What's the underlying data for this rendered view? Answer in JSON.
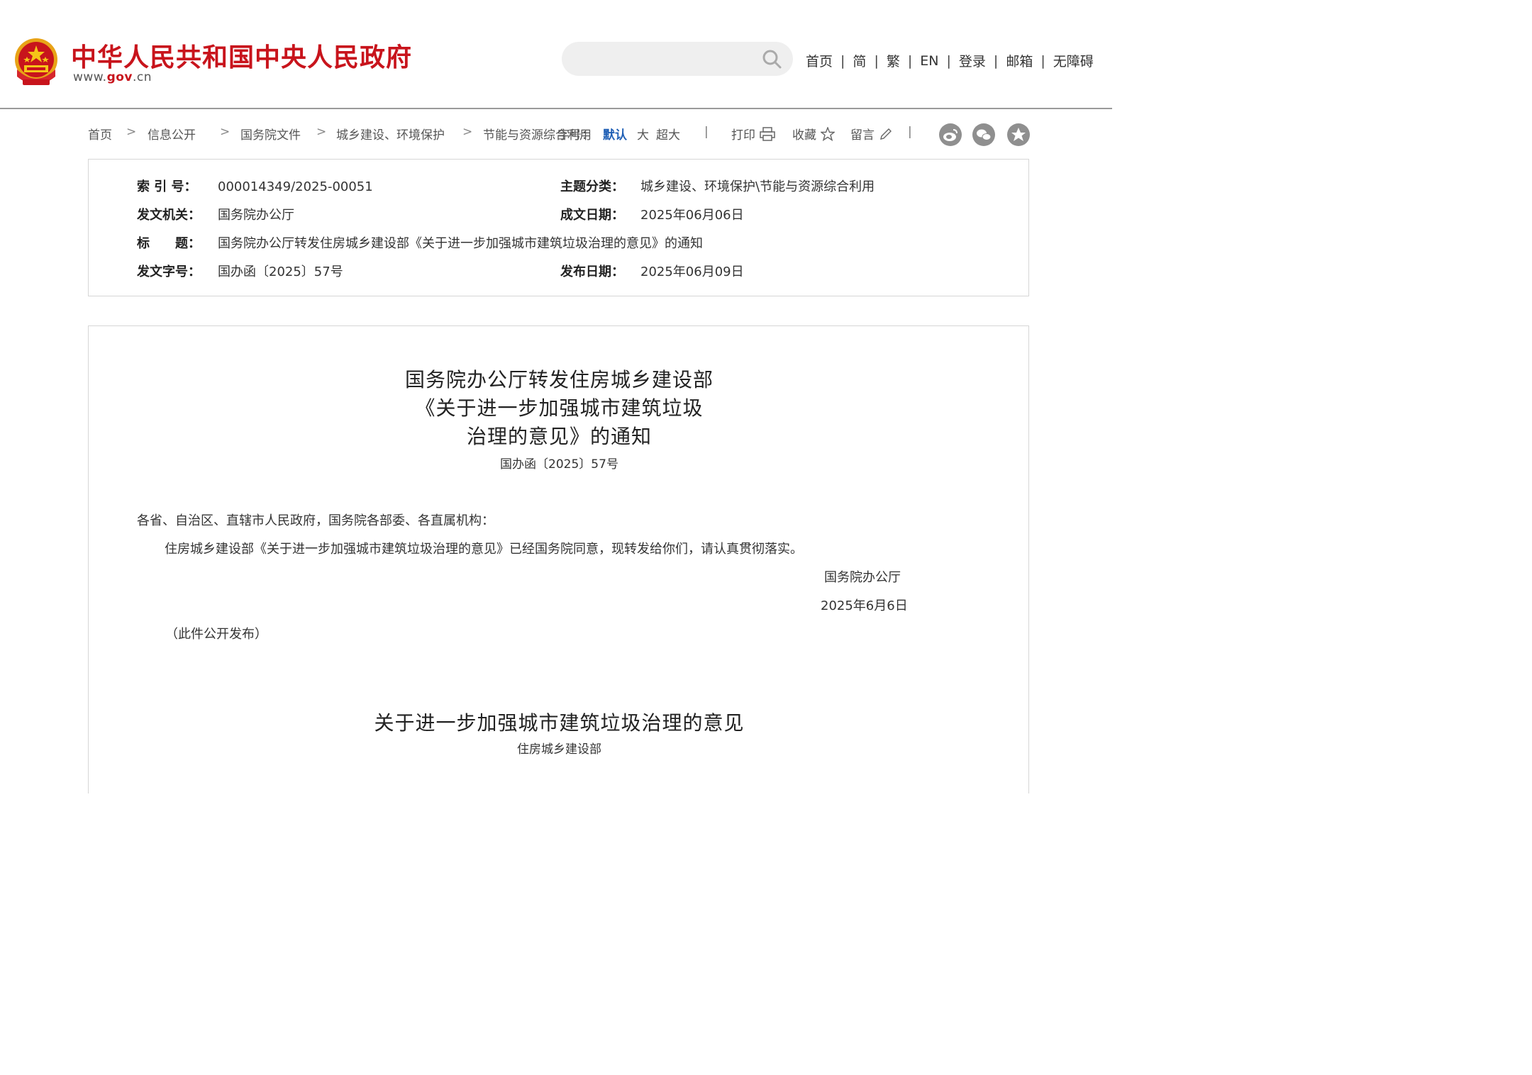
{
  "header": {
    "site_title": "中华人民共和国中央人民政府",
    "site_url_prefix": "www.",
    "site_url_domain": "gov",
    "site_url_suffix": ".cn",
    "search_placeholder": "",
    "nav": [
      "首页",
      "简",
      "繁",
      "EN",
      "登录",
      "邮箱",
      "无障碍"
    ],
    "nav_separator": "|",
    "emblem_color": "#c8141c",
    "emblem_gold": "#f5c518"
  },
  "breadcrumb": {
    "items": [
      "首页",
      "信息公开",
      "国务院文件",
      "城乡建设、环境保护",
      "节能与资源综合利用"
    ],
    "arrow": ">"
  },
  "tools": {
    "font_size_label": "字号：",
    "size_default": "默认",
    "size_large": "大",
    "size_xlarge": "超大",
    "separator": "|",
    "print": "打印",
    "favorite": "收藏",
    "comment": "留言"
  },
  "share": [
    "weibo-icon",
    "wechat-icon",
    "qzone-icon"
  ],
  "meta": {
    "index_label": "索 引 号：",
    "index_value": "000014349/2025-00051",
    "topic_label": "主题分类：",
    "topic_value": "城乡建设、环境保护\\节能与资源综合利用",
    "issuer_label": "发文机关：",
    "issuer_value": "国务院办公厅",
    "written_label": "成文日期：",
    "written_value": "2025年06月06日",
    "title_label": "标　　题：",
    "title_value": "国务院办公厅转发住房城乡建设部《关于进一步加强城市建筑垃圾治理的意见》的通知",
    "docno_label": "发文字号：",
    "docno_value": "国办函〔2025〕57号",
    "published_label": "发布日期：",
    "published_value": "2025年06月09日"
  },
  "document": {
    "title_line1": "国务院办公厅转发住房城乡建设部",
    "title_line2": "《关于进一步加强城市建筑垃圾",
    "title_line3": "治理的意见》的通知",
    "doc_number": "国办函〔2025〕57号",
    "addressee": "各省、自治区、直辖市人民政府，国务院各部委、各直属机构：",
    "body": "住房城乡建设部《关于进一步加强城市建筑垃圾治理的意见》已经国务院同意，现转发给你们，请认真贯彻落实。",
    "signature": "国务院办公厅",
    "date": "2025年6月6日",
    "note": "（此件公开发布）",
    "sub_title": "关于进一步加强城市建筑垃圾治理的意见",
    "sub_author": "住房城乡建设部"
  }
}
